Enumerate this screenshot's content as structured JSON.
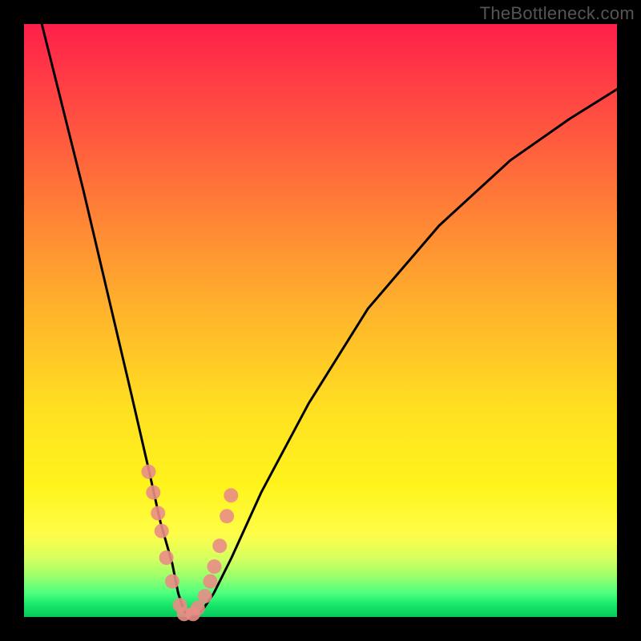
{
  "watermark": "TheBottleneck.com",
  "chart_data": {
    "type": "line",
    "title": "",
    "xlabel": "",
    "ylabel": "",
    "ylim": [
      0,
      100
    ],
    "xlim": [
      0,
      100
    ],
    "series": [
      {
        "name": "bottleneck-curve",
        "x": [
          3,
          6,
          10,
          14,
          18,
          21,
          23,
          25,
          26,
          27,
          28,
          29,
          30,
          32,
          35,
          40,
          48,
          58,
          70,
          82,
          92,
          100
        ],
        "values": [
          100,
          88,
          72,
          55,
          38,
          25,
          16,
          9,
          4,
          1,
          0,
          0,
          1,
          4,
          10,
          21,
          36,
          52,
          66,
          77,
          84,
          89
        ]
      }
    ],
    "markers": {
      "name": "highlighted-points",
      "x": [
        21.0,
        21.8,
        22.6,
        23.2,
        24.0,
        25.0,
        26.3,
        27.0,
        28.5,
        29.3,
        30.5,
        31.4,
        32.1,
        33.0,
        34.2,
        34.9
      ],
      "values": [
        24.5,
        21.0,
        17.5,
        14.5,
        10.0,
        6.0,
        2.0,
        0.5,
        0.5,
        1.5,
        3.5,
        6.0,
        8.5,
        12.0,
        17.0,
        20.5
      ]
    },
    "background_gradient": {
      "top": "#ff1f4a",
      "mid": "#ffe021",
      "bottom": "#08c95a"
    }
  }
}
